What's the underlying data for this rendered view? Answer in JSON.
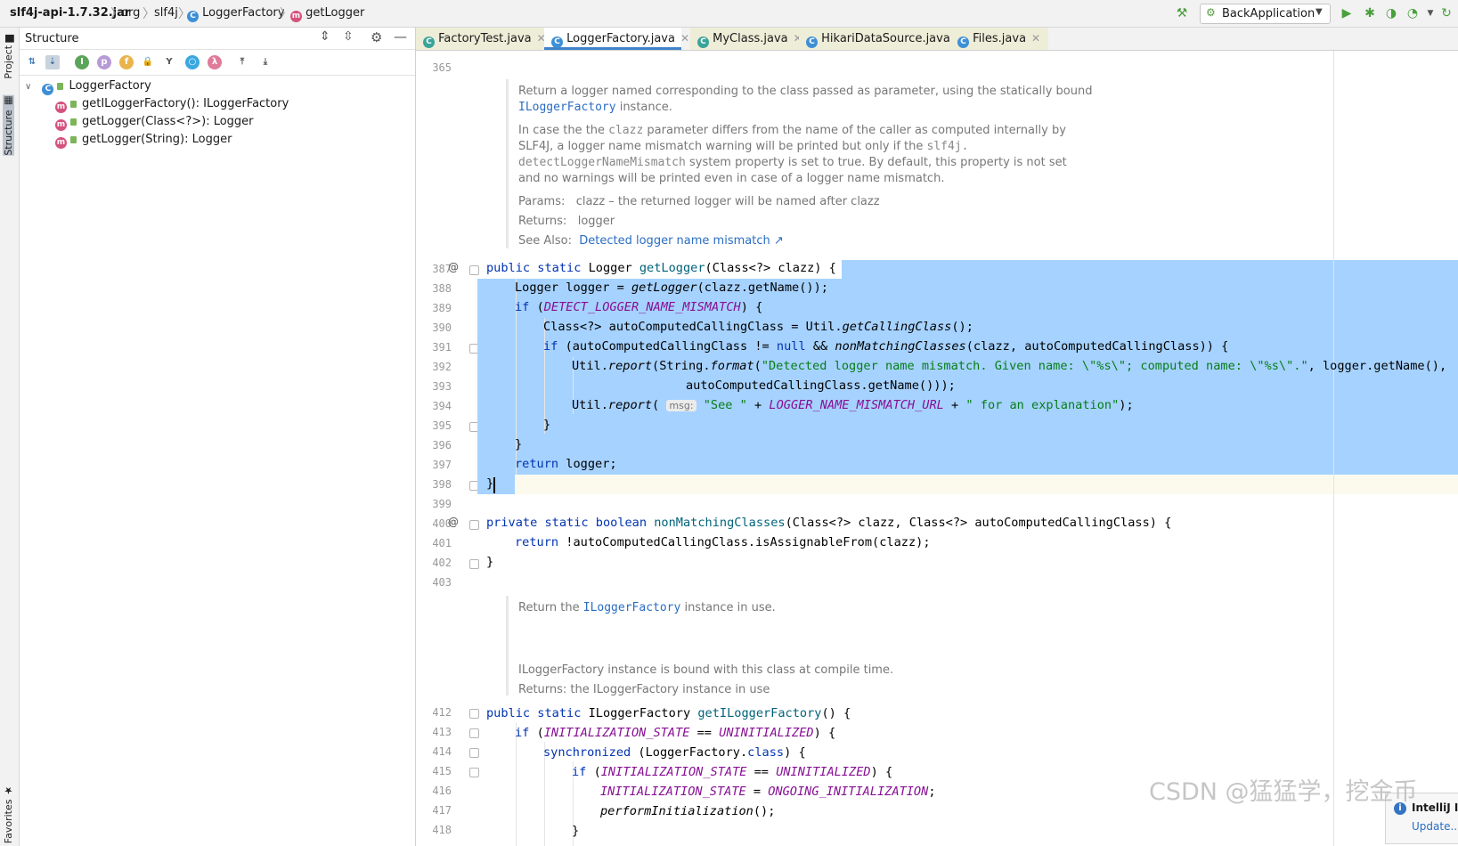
{
  "breadcrumb": {
    "jar": "slf4j-api-1.7.32.jar",
    "pkg1": "org",
    "pkg2": "slf4j",
    "cls": "LoggerFactory",
    "method": "getLogger"
  },
  "run_config": "BackApplication",
  "left_strip": {
    "project": "Project",
    "structure": "Structure",
    "favorites": "Favorites"
  },
  "structure": {
    "title": "Structure",
    "root": "LoggerFactory",
    "items": [
      "getILoggerFactory(): ILoggerFactory",
      "getLogger(Class<?>): Logger",
      "getLogger(String): Logger"
    ]
  },
  "tabs": [
    {
      "label": "FactoryTest.java"
    },
    {
      "label": "LoggerFactory.java"
    },
    {
      "label": "MyClass.java"
    },
    {
      "label": "HikariDataSource.java"
    },
    {
      "label": "Files.java"
    }
  ],
  "line_numbers": {
    "l365": "365",
    "l387": "387",
    "l388": "388",
    "l389": "389",
    "l390": "390",
    "l391": "391",
    "l392": "392",
    "l393": "393",
    "l394": "394",
    "l395": "395",
    "l396": "396",
    "l397": "397",
    "l398": "398",
    "l399": "399",
    "l400": "400",
    "l401": "401",
    "l402": "402",
    "l403": "403",
    "l412": "412",
    "l413": "413",
    "l414": "414",
    "l415": "415",
    "l416": "416",
    "l417": "417",
    "l418": "418"
  },
  "doc1": {
    "p1a": "Return a logger named corresponding to the class passed as parameter, using the statically bound",
    "p1b_link": "ILoggerFactory",
    "p1b_rest": " instance.",
    "p2a_pre": "In case the the ",
    "p2a_code": "clazz",
    "p2a_post": " parameter differs from the name of the caller as computed internally by",
    "p2b_pre": "SLF4J, a logger name mismatch warning will be printed but only if the ",
    "p2b_code": "slf4j.",
    "p2c_code": "detectLoggerNameMismatch",
    "p2c_post": " system property is set to true. By default, this property is not set",
    "p2d": "and no warnings will be printed even in case of a logger name mismatch.",
    "params_label": "Params:",
    "params_text": "clazz – the returned logger will be named after clazz",
    "returns_label": "Returns:",
    "returns_text": "logger",
    "see_label": "See Also:",
    "see_link": "Detected logger name mismatch ↗"
  },
  "doc2": {
    "p1_pre": "Return the ",
    "p1_link": "ILoggerFactory",
    "p1_post": " instance in use.",
    "p2": "ILoggerFactory instance is bound with this class at compile time.",
    "returns": "Returns: the ILoggerFactory instance in use"
  },
  "code": {
    "c387": {
      "a": "public static ",
      "b": "Logger ",
      "c": "getLogger",
      "d": "(Class<?> clazz) {"
    },
    "c388": {
      "a": "Logger logger = ",
      "b": "getLogger",
      "c": "(clazz.getName());"
    },
    "c389": {
      "a": "if ",
      "b": "(",
      "c": "DETECT_LOGGER_NAME_MISMATCH",
      "d": ") {"
    },
    "c390": {
      "a": "Class<?> autoComputedCallingClass = Util.",
      "b": "getCallingClass",
      "c": "();"
    },
    "c391": {
      "a": "if ",
      "b": "(autoComputedCallingClass != ",
      "c": "null",
      "d": " && ",
      "e": "nonMatchingClasses",
      "f": "(clazz, autoComputedCallingClass)) {"
    },
    "c392": {
      "a": "Util.",
      "b": "report",
      "c": "(String.",
      "d": "format",
      "e": "(",
      "f": "\"Detected logger name mismatch. Given name: \\\"%s\\\"; computed name: \\\"%s\\\".\"",
      "g": ", logger.getName(),"
    },
    "c393": {
      "a": "autoComputedCallingClass.getName()));"
    },
    "c394": {
      "a": "Util.",
      "b": "report",
      "c": "( ",
      "hint": "msg:",
      "d": " ",
      "e": "\"See \"",
      "f": " + ",
      "g": "LOGGER_NAME_MISMATCH_URL",
      "h": " + ",
      "i": "\" for an explanation\"",
      "j": ");"
    },
    "c395": {
      "a": "}"
    },
    "c396": {
      "a": "}"
    },
    "c397": {
      "a": "return ",
      "b": "logger;"
    },
    "c398": {
      "a": "}"
    },
    "c400": {
      "a": "private static boolean ",
      "b": "nonMatchingClasses",
      "c": "(Class<?> clazz, Class<?> autoComputedCallingClass) {"
    },
    "c401": {
      "a": "return ",
      "b": "!autoComputedCallingClass.isAssignableFrom(clazz);"
    },
    "c402": {
      "a": "}"
    },
    "c412": {
      "a": "public static ",
      "b": "ILoggerFactory ",
      "c": "getILoggerFactory",
      "d": "() {"
    },
    "c413": {
      "a": "if ",
      "b": "(",
      "c": "INITIALIZATION_STATE",
      "d": " == ",
      "e": "UNINITIALIZED",
      "f": ") {"
    },
    "c414": {
      "a": "synchronized ",
      "b": "(LoggerFactory.",
      "c": "class",
      "d": ") {"
    },
    "c415": {
      "a": "if ",
      "b": "(",
      "c": "INITIALIZATION_STATE",
      "d": " == ",
      "e": "UNINITIALIZED",
      "f": ") {"
    },
    "c416": {
      "a": "INITIALIZATION_STATE",
      "b": " = ",
      "c": "ONGOING_INITIALIZATION",
      "d": ";"
    },
    "c417": {
      "a": "performInitialization",
      "b": "();"
    },
    "c418": {
      "a": "}"
    }
  },
  "notification": {
    "title": "IntelliJ I",
    "link": "Update..."
  },
  "watermark": "CSDN @猛猛学，挖金币"
}
